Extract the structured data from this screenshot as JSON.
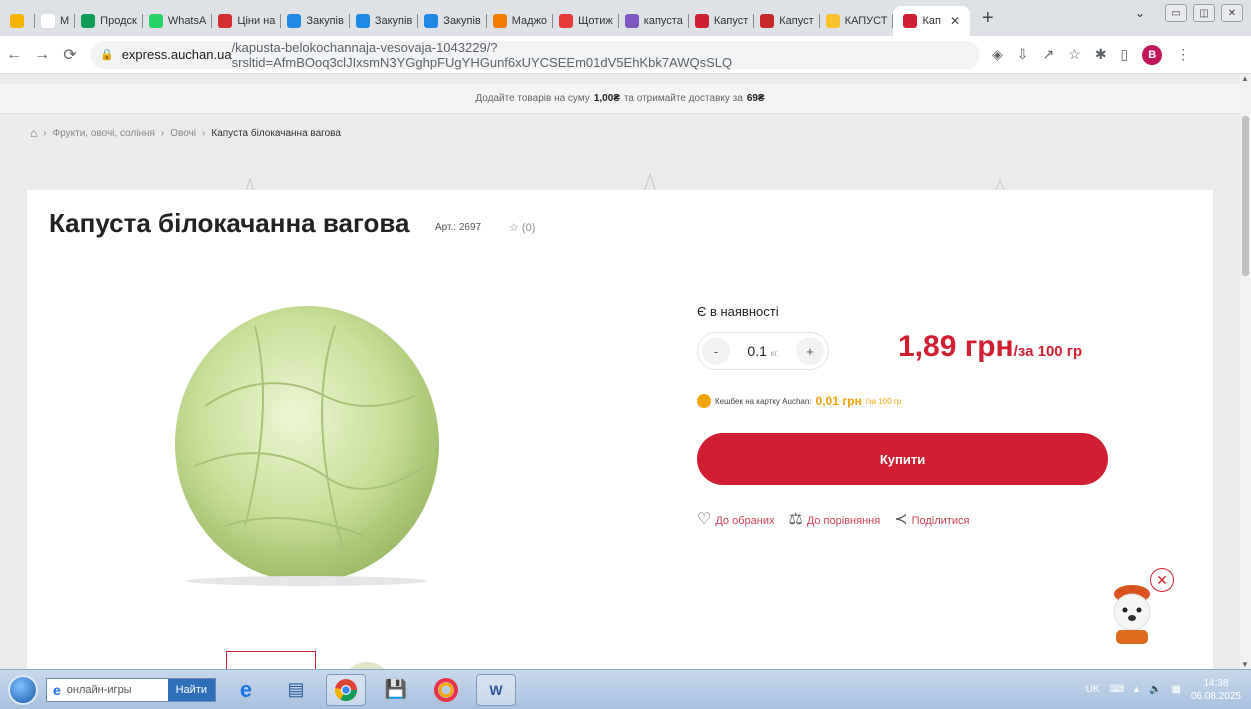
{
  "browser": {
    "tabs": [
      {
        "label": "",
        "color": "#f4b400"
      },
      {
        "label": "M",
        "color": "#ffffff"
      },
      {
        "label": "Продск",
        "color": "#0f9d58"
      },
      {
        "label": "WhatsA",
        "color": "#25d366"
      },
      {
        "label": "Ціни на",
        "color": "#d32f2f"
      },
      {
        "label": "Закупів",
        "color": "#1e88e5"
      },
      {
        "label": "Закупів",
        "color": "#1e88e5"
      },
      {
        "label": "Закупів",
        "color": "#1e88e5"
      },
      {
        "label": "Маджо",
        "color": "#f57c00"
      },
      {
        "label": "Щотиж",
        "color": "#e53935"
      },
      {
        "label": "капуста",
        "color": "#7e57c2"
      },
      {
        "label": "Капуст",
        "color": "#cf1f31"
      },
      {
        "label": "Капуст",
        "color": "#c62828"
      },
      {
        "label": "КАПУСТ",
        "color": "#fbc02d"
      }
    ],
    "active_tab": {
      "label": "Кап",
      "close": "✕"
    },
    "new_tab": "+",
    "url_host": "express.auchan.ua",
    "url_path": "/kapusta-belokochannaja-vesovaja-1043229/?srsltid=AfmBOoq3clJIxsmN3YGghpFUgYHGunf6xUYCSEEm01dV5EhKbk7AWQsSLQ",
    "profile_initial": "B"
  },
  "promo": {
    "before": "Додайте товарів на суму",
    "amount": "1,00₴",
    "middle": "та отримайте доставку за",
    "fee": "69₴"
  },
  "breadcrumb": {
    "items": [
      "Фрукти, овочі, соління",
      "Овочі"
    ],
    "current": "Капуста білокачанна вагова"
  },
  "product": {
    "title": "Капуста білокачанна вагова",
    "article": "Арт.: 2697",
    "rating": "☆ (0)",
    "availability": "Є в наявності",
    "qty_value": "0.1",
    "qty_unit": "кг.",
    "qty_minus": "-",
    "qty_plus": "+",
    "price": "1,89 грн",
    "price_unit": "/за 100 гр",
    "cashback_label": "Кешбек на картку Auchan:",
    "cashback_value": "0,01 грн",
    "cashback_unit": "/за 100 гр",
    "buy_label": "Купити",
    "favorites_label": "До обраних",
    "compare_label": "До порівняння",
    "share_label": "Поділитися"
  },
  "taskbar": {
    "search_text": "онлайн-игры",
    "search_button": "Найти",
    "lang": "UK",
    "time": "14:38",
    "date": "06.08.2025"
  },
  "colors": {
    "brand": "#cf1f31",
    "cashback": "#f0a30a"
  }
}
